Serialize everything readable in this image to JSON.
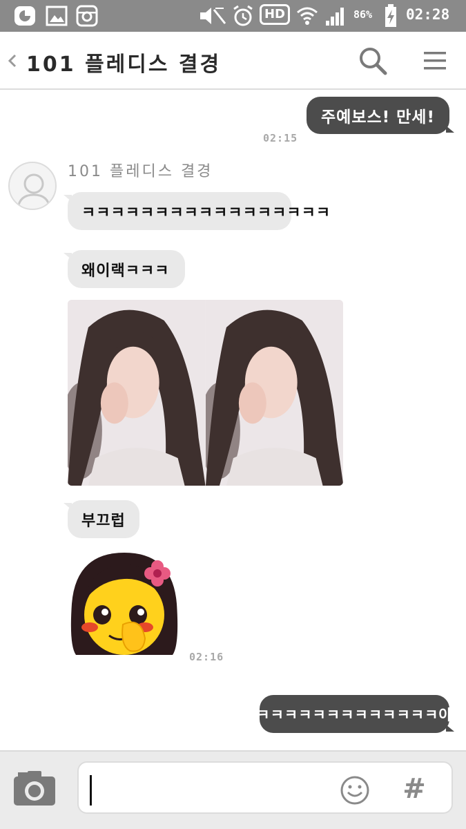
{
  "status_bar": {
    "battery": "86%",
    "time": "02:28",
    "network_badge": "HD",
    "icons": [
      "app-icon",
      "gallery-icon",
      "instagram-icon",
      "mute-icon",
      "alarm-icon",
      "hd-icon",
      "wifi-icon",
      "signal-icon",
      "battery-charging-icon"
    ]
  },
  "header": {
    "title": "101 플레디스 결경",
    "back_icon": "chevron-left-icon",
    "search_icon": "search-icon",
    "menu_icon": "hamburger-menu-icon"
  },
  "messages": {
    "out_1": {
      "text": "주예보스! 만세!",
      "time": "02:15"
    },
    "sender_name": "101 플레디스 결경",
    "in_1": {
      "text": "ㅋㅋㅋㅋㅋㅋㅋㅋㅋㅋㅋㅋㅋㅋㅋㅋㅋ"
    },
    "in_2": {
      "text": "왜이랙ㅋㅋㅋ"
    },
    "in_photo": {
      "type": "photo"
    },
    "in_3": {
      "text": "부끄럽"
    },
    "in_emoticon": {
      "type": "emoticon",
      "time": "02:16"
    },
    "out_2": {
      "text": "ㅋㅋㅋㅋㅋㅋㅋㅋㅋㅋㅋㅋㅋ아"
    }
  },
  "composer": {
    "value": "",
    "camera_icon": "camera-icon",
    "emoji_icon": "smiley-icon",
    "hash_label": "#"
  },
  "colors": {
    "status_bar": "#8a8a8a",
    "outgoing_bubble": "#4c4c4c",
    "incoming_bubble": "#e9e9e9",
    "timestamp": "#a8a8a8",
    "composer_bg": "#ebebeb"
  }
}
